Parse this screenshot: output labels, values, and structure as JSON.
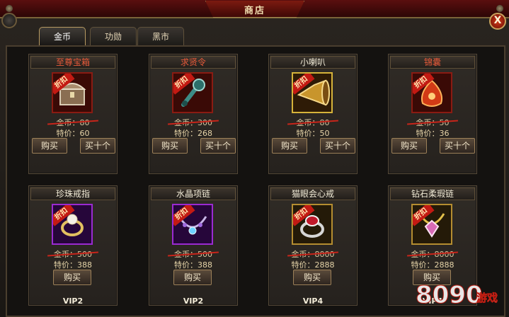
{
  "window": {
    "title": "商店",
    "close_label": "X"
  },
  "tabs": [
    {
      "label": "金币",
      "active": true
    },
    {
      "label": "功勋",
      "active": false
    },
    {
      "label": "黑市",
      "active": false
    }
  ],
  "items": [
    {
      "name": "至尊宝箱",
      "name_color": "red",
      "discount_badge": "折扣",
      "original_price": "金币：80",
      "sale_price": "特价：60",
      "buy_label": "购买",
      "buy10_label": "买十个",
      "icon": "treasure-chest-icon"
    },
    {
      "name": "求贤令",
      "name_color": "red",
      "discount_badge": "折扣",
      "original_price": "金币：300",
      "sale_price": "特价：268",
      "buy_label": "购买",
      "buy10_label": "买十个",
      "icon": "recruit-token-icon"
    },
    {
      "name": "小喇叭",
      "name_color": "white",
      "discount_badge": "折扣",
      "original_price": "金币：80",
      "sale_price": "特价：50",
      "buy_label": "购买",
      "buy10_label": "买十个",
      "icon": "horn-icon"
    },
    {
      "name": "锦囊",
      "name_color": "red",
      "discount_badge": "折扣",
      "original_price": "金币：50",
      "sale_price": "特价：36",
      "buy_label": "购买",
      "buy10_label": "买十个",
      "icon": "silk-pouch-icon"
    },
    {
      "name": "珍珠戒指",
      "name_color": "white",
      "discount_badge": "折扣",
      "original_price": "金币：500",
      "sale_price": "特价：388",
      "buy_label": "购买",
      "vip": "VIP2",
      "icon": "pearl-ring-icon"
    },
    {
      "name": "水晶项链",
      "name_color": "white",
      "discount_badge": "折扣",
      "original_price": "金币：500",
      "sale_price": "特价：388",
      "buy_label": "购买",
      "vip": "VIP2",
      "icon": "crystal-necklace-icon"
    },
    {
      "name": "猫眼会心戒",
      "name_color": "white",
      "discount_badge": "折扣",
      "original_price": "金币：8000",
      "sale_price": "特价：2888",
      "buy_label": "购买",
      "vip": "VIP4",
      "icon": "cats-eye-ring-icon"
    },
    {
      "name": "钻石柔瑕链",
      "name_color": "white",
      "discount_badge": "折扣",
      "original_price": "金币：8000",
      "sale_price": "特价：2888",
      "buy_label": "购买",
      "vip": "VIP4",
      "icon": "diamond-chain-icon"
    }
  ],
  "watermark": {
    "text": "8090游戏"
  },
  "colors": {
    "accent_red": "#e75a3a",
    "discount_red": "#c31a13",
    "gold_border": "#d6b33a",
    "purple_border": "#9a2ad1"
  }
}
